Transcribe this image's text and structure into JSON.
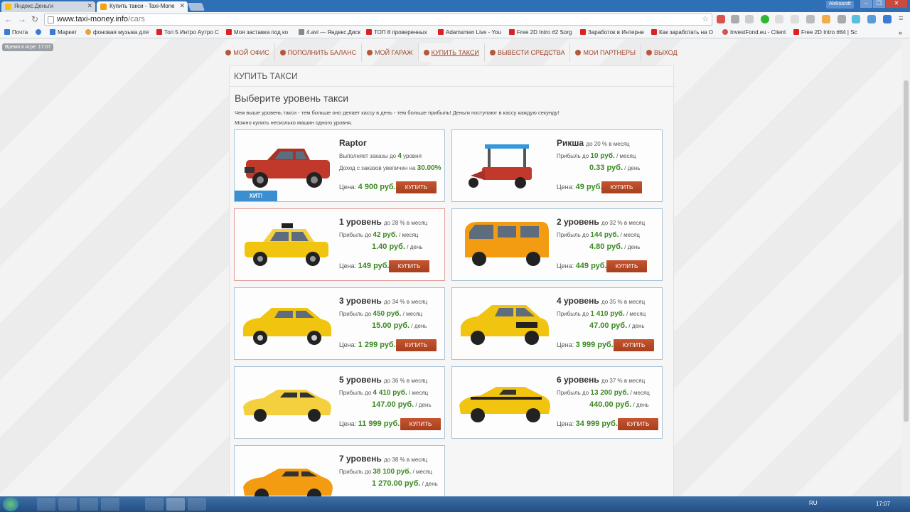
{
  "browser": {
    "tabs": [
      {
        "title": "Яндекс.Деньги",
        "active": false
      },
      {
        "title": "Купить такси - Taxi-Mone",
        "active": true
      }
    ],
    "user": "Aleksandr",
    "url_host": "www.taxi-money.info",
    "url_path": "/cars",
    "bookmarks": [
      "Почта",
      "Маркет",
      "фоновая музыка для",
      "Топ 5 Интро Aутро С",
      "Моя заставка под ко",
      "4.avi — Яндекс.Диск",
      "ТОП 8 проверенных",
      "Adamsmen Live - You",
      "Free 2D Intro #2 Sorg",
      "Заработок в Интерне",
      "Как заработать на O",
      "InvestFond.eu - Client",
      "Free 2D Intro #84 | Sc"
    ]
  },
  "game_time": "Время в игре: 17:07",
  "menu": [
    {
      "label": "МОЙ ОФИС",
      "icon": "office-icon"
    },
    {
      "label": "ПОПОЛНИТЬ БАЛАНС",
      "icon": "coin-icon"
    },
    {
      "label": "МОЙ ГАРАЖ",
      "icon": "garage-icon"
    },
    {
      "label": "КУПИТЬ ТАКСИ",
      "icon": "taxi-icon",
      "active": true
    },
    {
      "label": "ВЫВЕСТИ СРЕДСТВА",
      "icon": "withdraw-icon"
    },
    {
      "label": "МОИ ПАРТНЕРЫ",
      "icon": "partners-icon"
    },
    {
      "label": "ВЫХОД",
      "icon": "exit-icon"
    }
  ],
  "panel": {
    "title": "КУПИТЬ ТАКСИ",
    "heading": "Выберите уровень такси",
    "desc1": "Чем выше уровень такси - тем больше оно делает кассу в день - тем больше прибыль! Деньги поступают в кассу каждую секунду!",
    "desc2": "Можно купить несколько машин одного уровня."
  },
  "labels": {
    "profit_prefix": "Прибыль до",
    "per_month": "/ месяц",
    "per_day": "/ день",
    "price_prefix": "Цена:",
    "buy": "КУПИТЬ"
  },
  "raptor": {
    "name": "Raptor",
    "line1_prefix": "Выполняет заказы до",
    "line1_value": "4",
    "line1_suffix": "уровня",
    "line2_prefix": "Доход с заказов увеличен на",
    "line2_value": "30.00%",
    "price": "4 900 руб.",
    "badge": "ХИТ!"
  },
  "cars": [
    {
      "name": "Рикша",
      "pct": "до 20 % в месяц",
      "month": "10 руб.",
      "day": "0.33 руб.",
      "price": "49 руб.",
      "color": "#c0392b"
    },
    {
      "name": "1 уровень",
      "pct": "до 28 % в месяц",
      "month": "42 руб.",
      "day": "1.40 руб.",
      "price": "149 руб.",
      "color": "#f1c40f"
    },
    {
      "name": "2 уровень",
      "pct": "до 32 % в месяц",
      "month": "144 руб.",
      "day": "4.80 руб.",
      "price": "449 руб.",
      "color": "#f39c12"
    },
    {
      "name": "3 уровень",
      "pct": "до 34 % в месяц",
      "month": "450 руб.",
      "day": "15.00 руб.",
      "price": "1 299 руб.",
      "color": "#f1c40f"
    },
    {
      "name": "4 уровень",
      "pct": "до 35 % в месяц",
      "month": "1 410 руб.",
      "day": "47.00 руб.",
      "price": "3 999 руб.",
      "color": "#f1c40f"
    },
    {
      "name": "5 уровень",
      "pct": "до 36 % в месяц",
      "month": "4 410 руб.",
      "day": "147.00 руб.",
      "price": "11 999 руб.",
      "color": "#f4d03f"
    },
    {
      "name": "6 уровень",
      "pct": "до 37 % в месяц",
      "month": "13 200 руб.",
      "day": "440.00 руб.",
      "price": "34 999 руб.",
      "color": "#f1c40f"
    },
    {
      "name": "7 уровень",
      "pct": "до 38 % в месяц",
      "month": "38 100 руб.",
      "day": "1 270.00 руб.",
      "price": "",
      "color": "#f39c12"
    }
  ],
  "taskbar": {
    "lang": "RU",
    "clock": "17:07"
  }
}
